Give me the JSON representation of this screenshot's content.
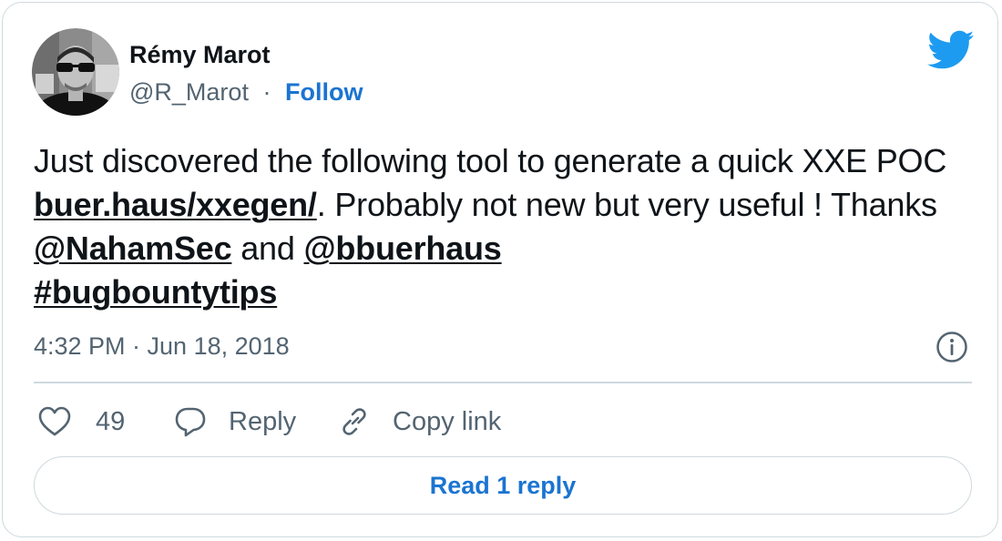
{
  "author": {
    "name": "Rémy Marot",
    "handle": "@R_Marot",
    "separator": "·",
    "follow_label": "Follow",
    "avatar": "avatar-photo"
  },
  "brand": {
    "icon": "twitter-bird-icon",
    "color": "#1d9bf0"
  },
  "tweet": {
    "text_1": "Just discovered the following tool to generate a quick XXE POC ",
    "link_1": "buer.haus/xxegen/",
    "text_2": ". Probably not new but very useful ! Thanks ",
    "mention_1": "@NahamSec",
    "text_3": " and ",
    "mention_2": "@bbuerhaus",
    "hashtag": "#bugbountytips"
  },
  "meta": {
    "timestamp": "4:32 PM · Jun 18, 2018",
    "info_icon": "info-icon"
  },
  "actions": {
    "like_icon": "heart-icon",
    "like_count": "49",
    "reply_icon": "speech-bubble-icon",
    "reply_label": "Reply",
    "copy_icon": "link-icon",
    "copy_label": "Copy link"
  },
  "footer": {
    "read_replies_label": "Read 1 reply"
  },
  "colors": {
    "text_primary": "#0f1419",
    "text_secondary": "#536471",
    "accent": "#1b74d1",
    "border": "#cfd9de"
  }
}
